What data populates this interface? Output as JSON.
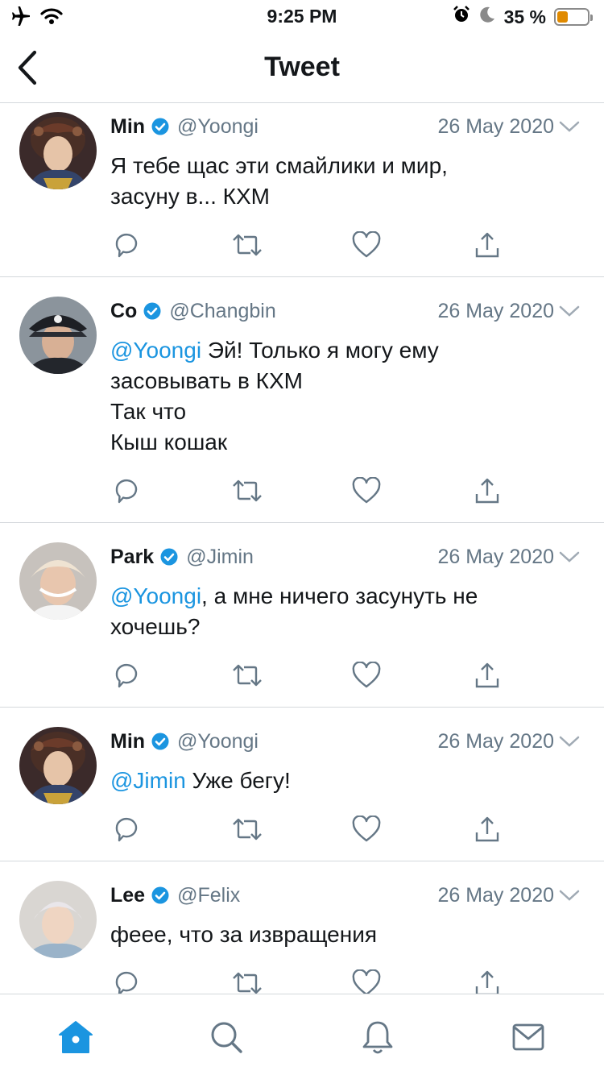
{
  "status_bar": {
    "time": "9:25 PM",
    "battery_percent_label": "35 %",
    "battery_level": 0.35,
    "battery_color": "#e08a00",
    "left_icons": [
      "airplane-icon",
      "wifi-icon"
    ],
    "right_icons": [
      "alarm-icon",
      "moon-icon",
      "battery-icon"
    ]
  },
  "nav": {
    "title": "Tweet",
    "back_icon": "chevron-left-icon"
  },
  "colors": {
    "accent": "#1b95e0",
    "secondary_text": "#657786",
    "divider": "#d4d8dc"
  },
  "tweets": [
    {
      "name": "Min",
      "handle": "@Yoongi",
      "date": "26 May 2020",
      "lines": [
        {
          "mention": "",
          "text": "Я тебе щас эти смайлики и мир,"
        },
        {
          "mention": "",
          "text": "засуну в... КХМ"
        }
      ]
    },
    {
      "name": "Co",
      "handle": "@Changbin",
      "date": "26 May 2020",
      "lines": [
        {
          "mention": "@Yoongi",
          "text": " Эй! Только я могу ему"
        },
        {
          "mention": "",
          "text": "засовывать в КХМ"
        },
        {
          "mention": "",
          "text": "Так что"
        },
        {
          "mention": "",
          "text": "Кыш кошак"
        }
      ]
    },
    {
      "name": "Park",
      "handle": "@Jimin",
      "date": "26 May 2020",
      "lines": [
        {
          "mention": "@Yoongi",
          "text": ", а мне ничего засунуть не"
        },
        {
          "mention": "",
          "text": "хочешь?"
        }
      ]
    },
    {
      "name": "Min",
      "handle": "@Yoongi",
      "date": "26 May 2020",
      "lines": [
        {
          "mention": "@Jimin",
          "text": " Уже бегу!"
        }
      ]
    },
    {
      "name": "Lee",
      "handle": "@Felix",
      "date": "26 May 2020",
      "lines": [
        {
          "mention": "",
          "text": "феее, что за извращения"
        }
      ]
    }
  ],
  "action_icons": [
    "reply-icon",
    "retweet-icon",
    "like-icon",
    "share-icon"
  ],
  "tab_bar": {
    "items": [
      "home-icon",
      "search-icon",
      "notifications-icon",
      "messages-icon"
    ],
    "active": "home-icon"
  }
}
